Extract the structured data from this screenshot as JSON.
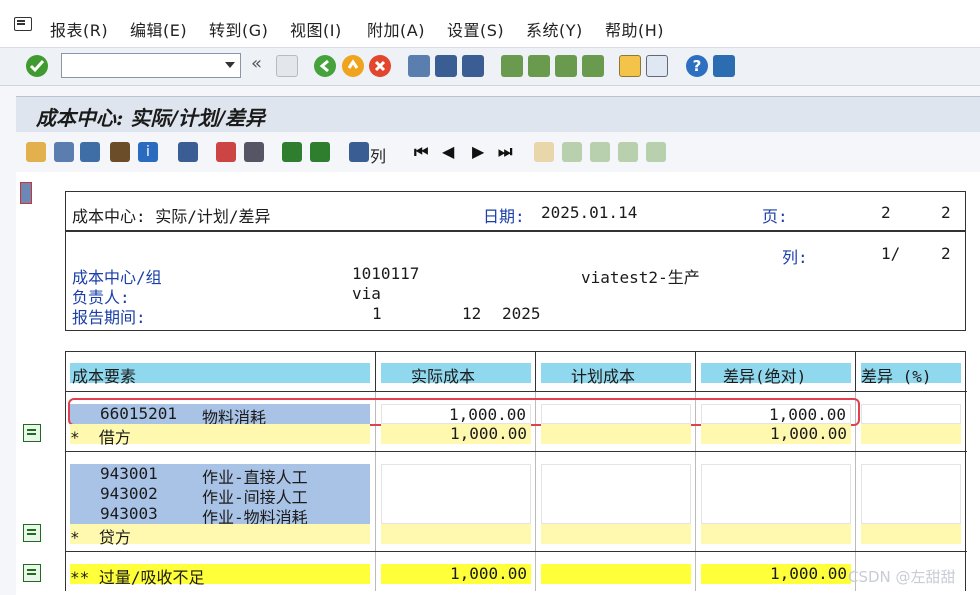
{
  "menu": [
    "报表(R)",
    "编辑(E)",
    "转到(G)",
    "视图(I)",
    "附加(A)",
    "设置(S)",
    "系统(Y)",
    "帮助(H)"
  ],
  "toolbar": {
    "command_value": "",
    "back_label": "«"
  },
  "page_title": "成本中心: 实际/计划/差异",
  "app_toolbar": {
    "columns_label": "列"
  },
  "report": {
    "header": {
      "title": "成本中心: 实际/计划/差异",
      "date_label": "日期:",
      "date_value": "2025.01.14",
      "page_label": "页:",
      "page_value": "2",
      "page_total": "2",
      "col_label": "列:",
      "col_value": "1/",
      "col_total": "2",
      "cc_label": "成本中心/组",
      "cc_value": "1010117",
      "cc_desc": "viatest2-生产",
      "owner_label": "负责人:",
      "owner_value": "via",
      "period_label": "报告期间:",
      "period_from": "1",
      "period_to": "12",
      "period_year": "2025"
    },
    "columns": [
      "成本要素",
      "实际成本",
      "计划成本",
      "差异(绝对)",
      "差异 (%)"
    ],
    "debit_rows": [
      {
        "element": "66015201",
        "desc": "物料消耗",
        "actual": "1,000.00",
        "plan": "",
        "var_abs": "1,000.00",
        "var_pct": ""
      }
    ],
    "debit_total": {
      "label": "*  借方",
      "actual": "1,000.00",
      "var_abs": "1,000.00"
    },
    "credit_rows": [
      {
        "element": "943001",
        "desc": "作业-直接人工"
      },
      {
        "element": "943002",
        "desc": "作业-间接人工"
      },
      {
        "element": "943003",
        "desc": "作业-物料消耗"
      }
    ],
    "credit_total": {
      "label": "*  贷方"
    },
    "grand_total": {
      "label": "** 过量/吸收不足",
      "actual": "1,000.00",
      "var_abs": "1,000.00"
    }
  },
  "watermark": "CSDN @左甜甜",
  "colors": {
    "header_cyan": "#8fd8ee",
    "row_blue": "#a9c3e6",
    "subtotal_yellow": "#fff9b0",
    "total_yellow": "#ffff3a",
    "highlight_red": "#e0404f"
  }
}
